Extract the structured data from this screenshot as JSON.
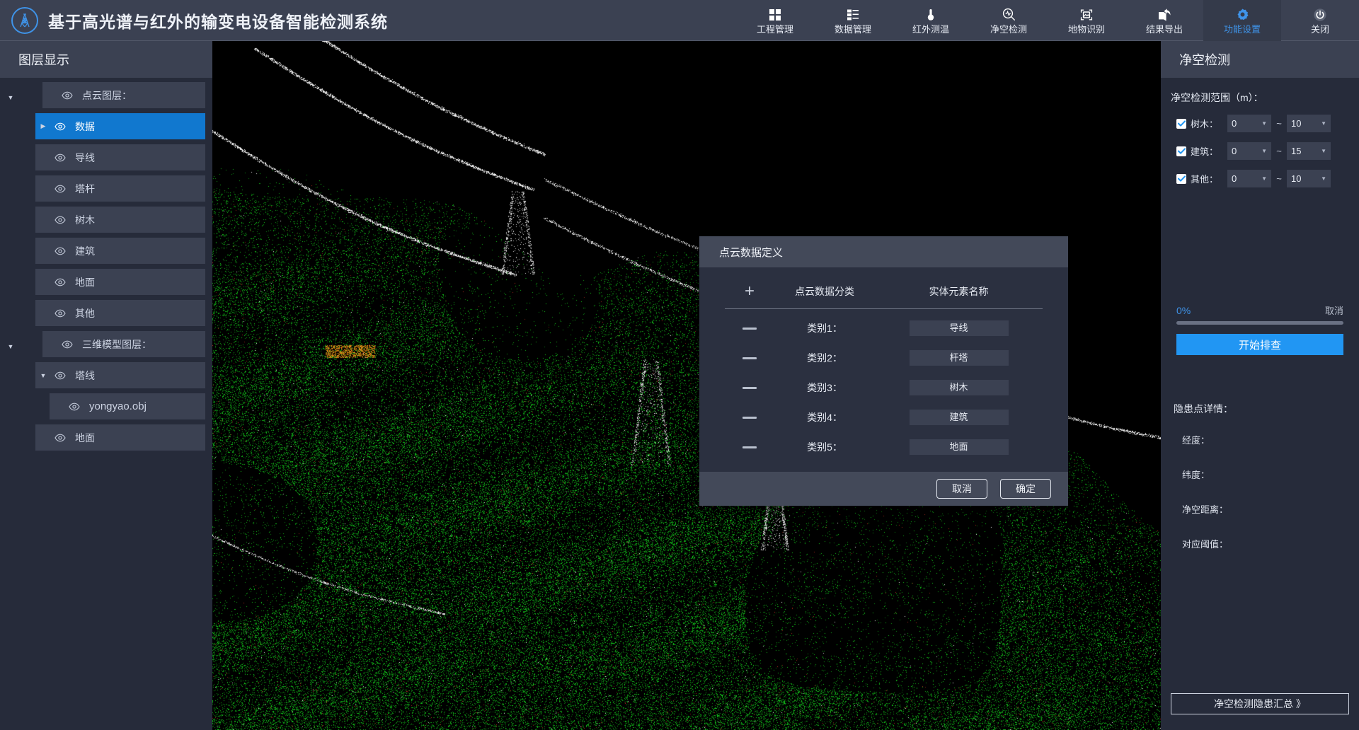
{
  "header": {
    "logo_icon": "transmission-tower-icon",
    "title": "基于高光谱与红外的输变电设备智能检测系统",
    "nav": [
      {
        "label": "工程管理",
        "icon": "grid-icon",
        "active": false
      },
      {
        "label": "数据管理",
        "icon": "database-list-icon",
        "active": false
      },
      {
        "label": "红外测温",
        "icon": "thermometer-icon",
        "active": false
      },
      {
        "label": "净空检测",
        "icon": "magnifier-pulse-icon",
        "active": false
      },
      {
        "label": "地物识别",
        "icon": "image-scan-icon",
        "active": false
      },
      {
        "label": "结果导出",
        "icon": "export-share-icon",
        "active": false
      },
      {
        "label": "功能设置",
        "icon": "gear-icon",
        "active": true
      },
      {
        "label": "关闭",
        "icon": "power-icon",
        "active": false
      }
    ]
  },
  "left_panel": {
    "title": "图层显示",
    "tree": [
      {
        "label": "点云图层：",
        "depth": 0,
        "caret": "down",
        "arrow": "",
        "eye": true,
        "selected": false
      },
      {
        "label": "数据",
        "depth": 1,
        "caret": "",
        "arrow": "right",
        "eye": true,
        "selected": true
      },
      {
        "label": "导线",
        "depth": 1,
        "caret": "",
        "arrow": "",
        "eye": true,
        "selected": false
      },
      {
        "label": "塔杆",
        "depth": 1,
        "caret": "",
        "arrow": "",
        "eye": true,
        "selected": false
      },
      {
        "label": "树木",
        "depth": 1,
        "caret": "",
        "arrow": "",
        "eye": true,
        "selected": false
      },
      {
        "label": "建筑",
        "depth": 1,
        "caret": "",
        "arrow": "",
        "eye": true,
        "selected": false
      },
      {
        "label": "地面",
        "depth": 1,
        "caret": "",
        "arrow": "",
        "eye": true,
        "selected": false
      },
      {
        "label": "其他",
        "depth": 1,
        "caret": "",
        "arrow": "",
        "eye": true,
        "selected": false
      },
      {
        "label": "三维模型图层：",
        "depth": 0,
        "caret": "down",
        "arrow": "",
        "eye": true,
        "selected": false
      },
      {
        "label": "塔线",
        "depth": 1,
        "caret": "",
        "arrow": "down",
        "eye": true,
        "selected": false
      },
      {
        "label": "yongyao.obj",
        "depth": 2,
        "caret": "",
        "arrow": "",
        "eye": true,
        "selected": false,
        "file": true
      },
      {
        "label": "地面",
        "depth": 1,
        "caret": "",
        "arrow": "",
        "eye": true,
        "selected": false
      }
    ]
  },
  "right_panel": {
    "title": "净空检测",
    "range_title": "净空检测范围（m）：",
    "ranges": [
      {
        "label": "树木：",
        "checked": true,
        "min": "0",
        "max": "10",
        "separator": "~"
      },
      {
        "label": "建筑：",
        "checked": true,
        "min": "0",
        "max": "15",
        "separator": "~"
      },
      {
        "label": "其他：",
        "checked": true,
        "min": "0",
        "max": "10",
        "separator": "~"
      }
    ],
    "progress": {
      "percent_label": "0%",
      "percent_value": 0,
      "cancel_label": "取消"
    },
    "start_button": "开始排查",
    "detail": {
      "title": "隐患点详情：",
      "fields": [
        "经度：",
        "纬度：",
        "净空距离：",
        "对应阈值："
      ]
    },
    "summary_button": "净空检测隐患汇总 》"
  },
  "modal": {
    "title": "点云数据定义",
    "add_icon": "plus-icon",
    "columns": [
      "点云数据分类",
      "实体元素名称"
    ],
    "rows": [
      {
        "remove_icon": "minus-icon",
        "category": "类别1：",
        "name": "导线"
      },
      {
        "remove_icon": "minus-icon",
        "category": "类别2：",
        "name": "杆塔"
      },
      {
        "remove_icon": "minus-icon",
        "category": "类别3：",
        "name": "树木"
      },
      {
        "remove_icon": "minus-icon",
        "category": "类别4：",
        "name": "建筑"
      },
      {
        "remove_icon": "minus-icon",
        "category": "类别5：",
        "name": "地面"
      }
    ],
    "cancel_label": "取消",
    "confirm_label": "确定"
  },
  "viewport": {
    "name": "point-cloud-3d-view",
    "colors": {
      "background": "#000000",
      "vegetation": "#22b022",
      "highlight": "#ffffff",
      "hazard": "#b03020"
    }
  },
  "theme": {
    "accent": "#2196f3",
    "panel_bg": "#262b3a",
    "header_bg": "#3b4152",
    "selected_bg": "#1178cf"
  }
}
